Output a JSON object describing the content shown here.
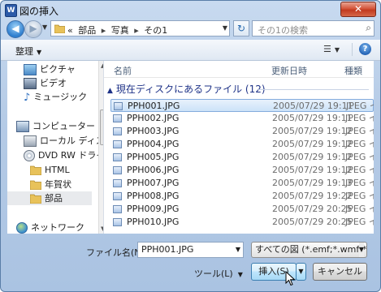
{
  "window": {
    "title": "図の挿入",
    "app_icon_letter": "W",
    "close_label": "✕"
  },
  "nav": {
    "breadcrumb": [
      "«",
      "部品",
      "写真",
      "その1"
    ],
    "search_placeholder": "その1の検索"
  },
  "toolbar": {
    "organize_label": "整理"
  },
  "sidebar": {
    "items": [
      {
        "label": "ピクチャ",
        "icon": "pictures-icon"
      },
      {
        "label": "ビデオ",
        "icon": "video-icon"
      },
      {
        "label": "ミュージック",
        "icon": "music-icon"
      },
      {
        "label": "コンピューター",
        "icon": "computer-icon"
      },
      {
        "label": "ローカル ディス",
        "icon": "local-disk-icon"
      },
      {
        "label": "DVD RW ドライ",
        "icon": "dvd-drive-icon"
      },
      {
        "label": "HTML",
        "icon": "folder-icon"
      },
      {
        "label": "年賀状",
        "icon": "folder-icon"
      },
      {
        "label": "部品",
        "icon": "folder-icon",
        "selected": true
      },
      {
        "label": "ネットワーク",
        "icon": "network-icon"
      }
    ]
  },
  "columns": {
    "name": "名前",
    "date": "更新日時",
    "type": "種類"
  },
  "group_header": "現在ディスクにあるファイル (12)",
  "files": [
    {
      "name": "PPH001.JPG",
      "date": "2005/07/29 19:11",
      "type": "JPEG イ",
      "selected": true
    },
    {
      "name": "PPH002.JPG",
      "date": "2005/07/29 19:11",
      "type": "JPEG イ"
    },
    {
      "name": "PPH003.JPG",
      "date": "2005/07/29 19:12",
      "type": "JPEG イ"
    },
    {
      "name": "PPH004.JPG",
      "date": "2005/07/29 19:12",
      "type": "JPEG イ"
    },
    {
      "name": "PPH005.JPG",
      "date": "2005/07/29 19:12",
      "type": "JPEG イ"
    },
    {
      "name": "PPH006.JPG",
      "date": "2005/07/29 19:12",
      "type": "JPEG イ"
    },
    {
      "name": "PPH007.JPG",
      "date": "2005/07/29 19:13",
      "type": "JPEG イ"
    },
    {
      "name": "PPH008.JPG",
      "date": "2005/07/29 19:22",
      "type": "JPEG イ"
    },
    {
      "name": "PPH009.JPG",
      "date": "2005/07/29 20:25",
      "type": "JPEG イ"
    },
    {
      "name": "PPH010.JPG",
      "date": "2005/07/29 20:25",
      "type": "JPEG イ"
    }
  ],
  "footer": {
    "filename_label": "ファイル名(N):",
    "filename_value": "PPH001.JPG",
    "filter_value": "すべての図 (*.emf;*.wmf;*.j",
    "tools_label": "ツール(L)",
    "insert_label": "挿入(S)",
    "cancel_label": "キャンセル"
  }
}
